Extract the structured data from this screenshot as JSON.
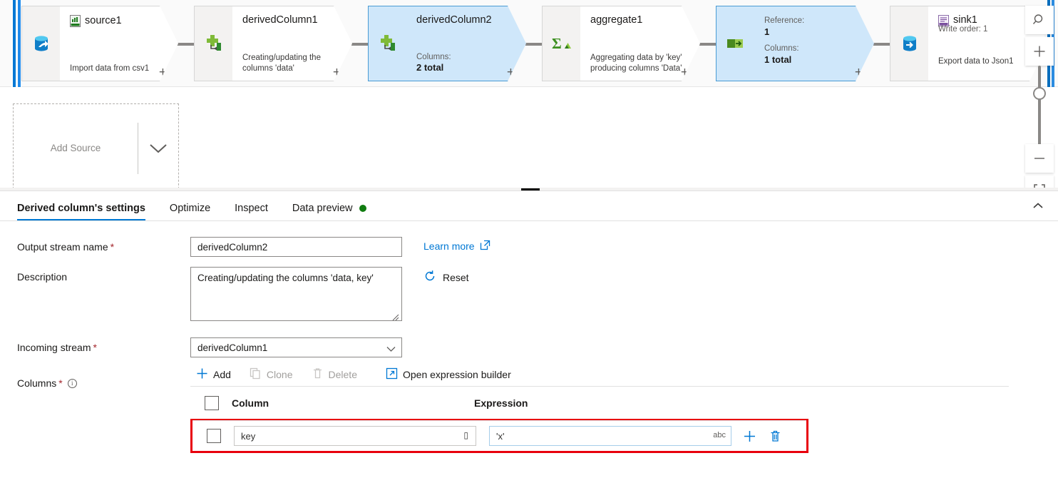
{
  "canvas": {
    "nodes": [
      {
        "id": "source1",
        "title": "source1",
        "icon": "csv-file-icon",
        "side_icon": "source-database-icon",
        "subtitle": "Import data from csv1",
        "selected": false
      },
      {
        "id": "derivedColumn1",
        "title": "derivedColumn1",
        "side_icon": "derived-column-icon",
        "subtitle": "Creating/updating the columns 'data'",
        "selected": false
      },
      {
        "id": "derivedColumn2",
        "title": "derivedColumn2",
        "side_icon": "derived-column-icon",
        "kv_label": "Columns:",
        "kv_value": "2 total",
        "selected": true
      },
      {
        "id": "aggregate1",
        "title": "aggregate1",
        "side_icon": "aggregate-sigma-icon",
        "subtitle": "Aggregating data by 'key' producing columns 'Data'",
        "selected": false
      },
      {
        "id": "reference1",
        "kv_label": "Reference:",
        "kv_value": "1",
        "kv_label2": "Columns:",
        "kv_value2": "1 total",
        "side_icon": "exists-arrow-icon",
        "selected": true
      },
      {
        "id": "sink1",
        "title": "sink1",
        "write_order": "Write order: 1",
        "icon": "json-file-icon",
        "side_icon": "sink-database-icon",
        "subtitle": "Export data to Json1",
        "selected": false
      }
    ],
    "add_source": {
      "label": "Add Source",
      "chevron": "chevron-down-icon"
    },
    "zoom_controls": {
      "search": "search-icon",
      "zoom_in": "plus-icon",
      "zoom_out": "minus-icon",
      "fit": "fit-to-screen-icon"
    }
  },
  "tabs": [
    {
      "label": "Derived column's settings",
      "active": true,
      "dot": false
    },
    {
      "label": "Optimize",
      "active": false,
      "dot": false
    },
    {
      "label": "Inspect",
      "active": false,
      "dot": false
    },
    {
      "label": "Data preview",
      "active": false,
      "dot": true
    }
  ],
  "collapse_icon": "chevron-up-icon",
  "form": {
    "output_stream": {
      "label": "Output stream name",
      "required": "*",
      "value": "derivedColumn2"
    },
    "description": {
      "label": "Description",
      "value": "Creating/updating the columns 'data, key'"
    },
    "incoming_stream": {
      "label": "Incoming stream",
      "required": "*",
      "value": "derivedColumn1",
      "chevron": "chevron-down-icon"
    },
    "learn_more": {
      "label": "Learn more",
      "icon": "external-link-icon"
    },
    "reset": {
      "label": "Reset",
      "icon": "refresh-icon"
    },
    "columns_label": {
      "label": "Columns",
      "required": "*",
      "info_icon": "info-icon"
    }
  },
  "toolbar": {
    "add": {
      "label": "Add",
      "icon": "plus-icon",
      "disabled": false
    },
    "clone": {
      "label": "Clone",
      "icon": "copy-icon",
      "disabled": true
    },
    "delete": {
      "label": "Delete",
      "icon": "trash-icon",
      "disabled": true
    },
    "expression_builder": {
      "label": "Open expression builder",
      "icon": "external-link-icon",
      "disabled": false
    }
  },
  "table": {
    "headers": {
      "column": "Column",
      "expression": "Expression"
    },
    "rows": [
      {
        "column": "key",
        "column_suffix_icon": "column-type-glyph",
        "expression": "'x'",
        "expression_type": "abc",
        "add_icon": "plus-icon",
        "delete_icon": "trash-icon"
      }
    ]
  },
  "colors": {
    "accent": "#0078d4",
    "highlight_box": "#e8000d",
    "selected_node": "#cfe7fa",
    "required_asterisk": "#a4262c",
    "preview_ok": "#107c10"
  }
}
